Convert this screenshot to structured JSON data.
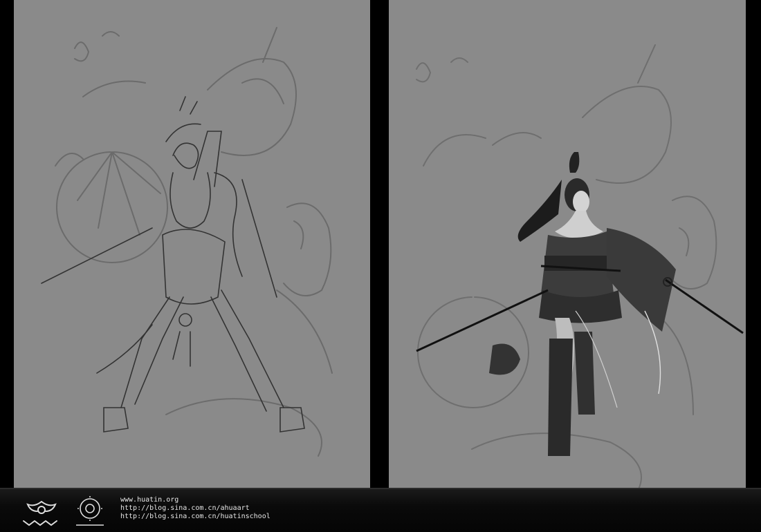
{
  "footer": {
    "links": [
      "www.huatin.org",
      "http://blog.sina.com.cn/ahuaart",
      "http://blog.sina.com.cn/huatinschool"
    ]
  },
  "colors": {
    "page_background": "#000000",
    "canvas_gray": "#8a8a8a",
    "sketch_line": "#5f5f5f",
    "ink_line": "#2a2a2a",
    "footer_text": "#e6e6e6"
  }
}
